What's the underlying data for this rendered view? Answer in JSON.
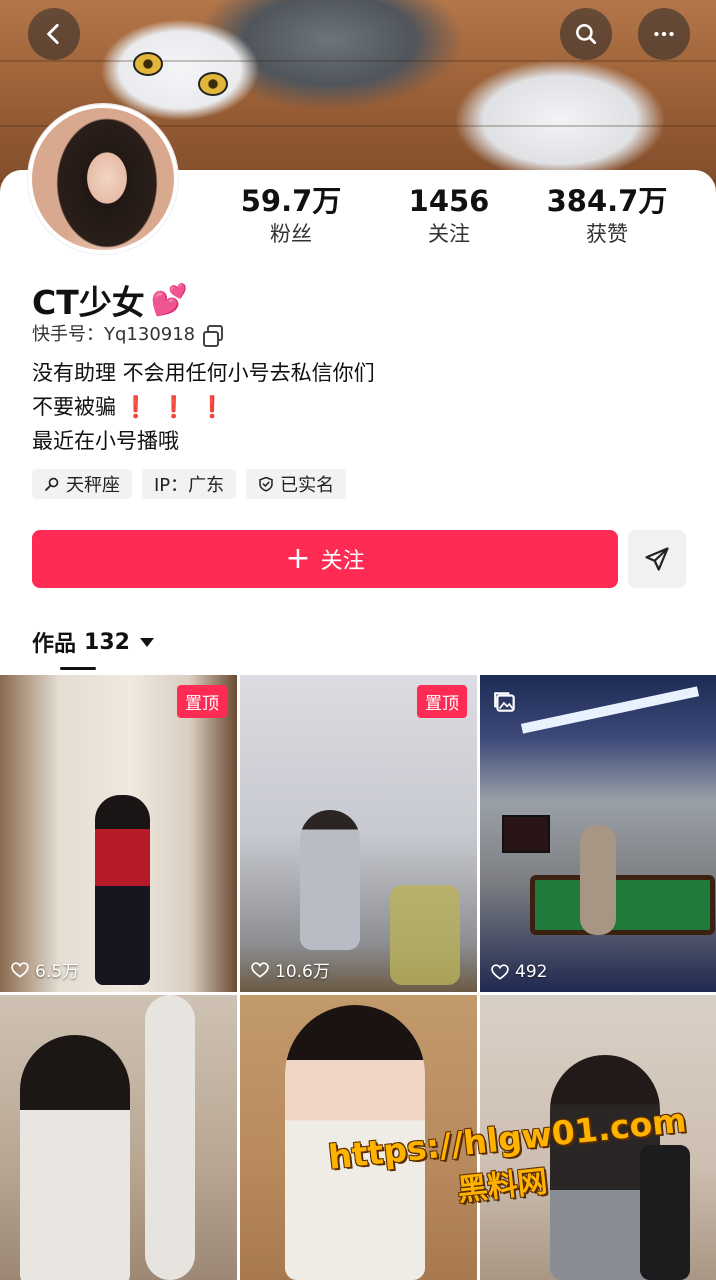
{
  "profile": {
    "name": "CT少女",
    "name_emoji": "💕",
    "kuaishou_id": "快手号：Yq130918",
    "bio_lines": [
      "没有助理 不会用任何小号去私信你们",
      "不要被骗",
      "最近在小号播哦"
    ],
    "bio_marks": "❗❗❗"
  },
  "stats": [
    {
      "value": "59.7万",
      "label": "粉丝"
    },
    {
      "value": "1456",
      "label": "关注"
    },
    {
      "value": "384.7万",
      "label": "获赞"
    }
  ],
  "tags": [
    "天秤座",
    "IP：广东",
    "已实名"
  ],
  "actions": {
    "follow": "关注"
  },
  "works": {
    "label": "作品",
    "count": "132"
  },
  "tiles": [
    {
      "pinned": "置顶",
      "likes": "6.5万"
    },
    {
      "pinned": "置顶",
      "likes": "10.6万"
    },
    {
      "likes": "492",
      "album": true
    },
    {},
    {},
    {}
  ],
  "watermark": {
    "url": "https://hlgw01.com",
    "text": "黑料网"
  },
  "icons": [
    "back-icon",
    "search-icon",
    "more-icon",
    "copy-icon",
    "location-icon",
    "verified-icon",
    "plus-icon",
    "send-icon",
    "caret-down-icon",
    "heart-icon",
    "album-icon"
  ],
  "colors": {
    "accent": "#fe2c55",
    "tag_bg": "#f2f2f4",
    "bang": "#e21c2a"
  }
}
